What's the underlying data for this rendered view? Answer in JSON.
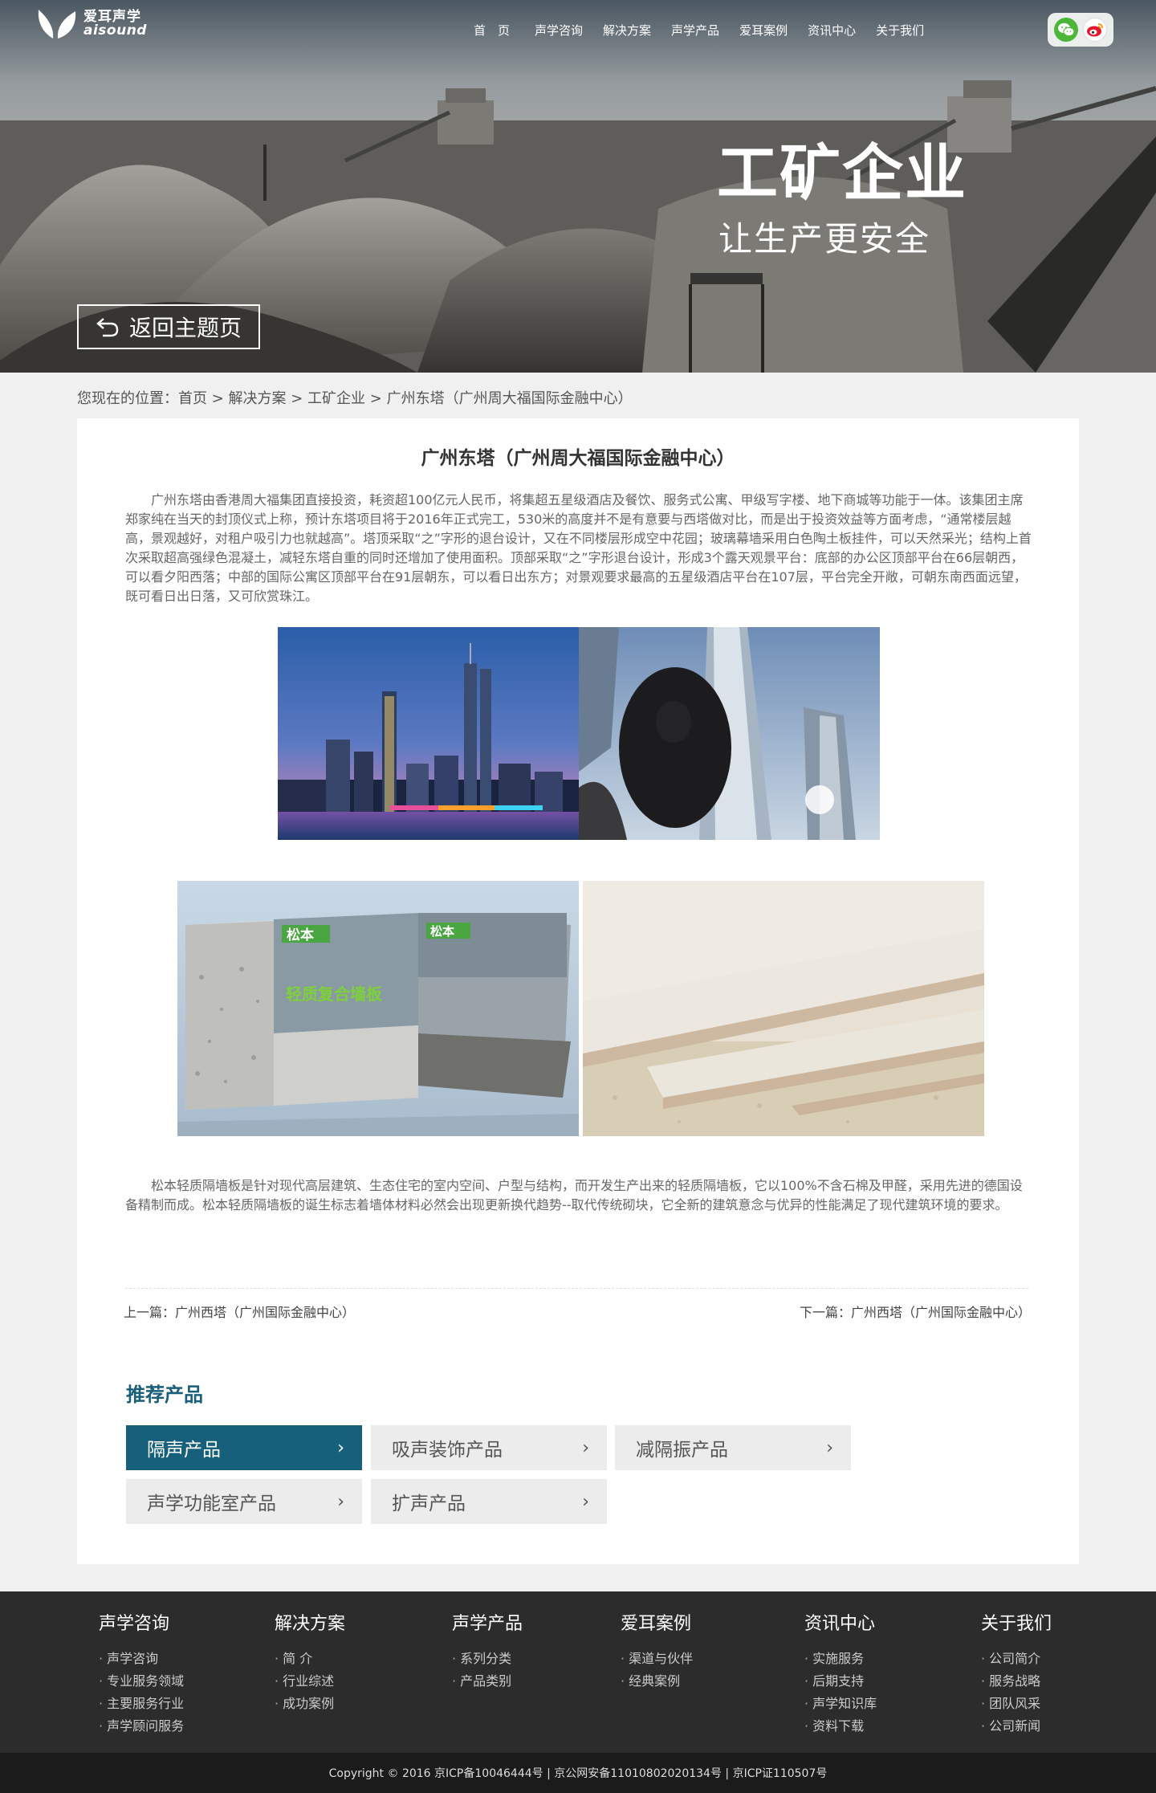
{
  "brand": {
    "name_cn": "爱耳声学",
    "name_en": "aisound"
  },
  "nav": [
    "首　页",
    "声学咨询",
    "解决方案",
    "声学产品",
    "爱耳案例",
    "资讯中心",
    "关于我们"
  ],
  "hero": {
    "title": "工矿企业",
    "subtitle": "让生产更安全",
    "back_label": "返回主题页"
  },
  "breadcrumb": {
    "text": "您现在的位置：首页 > 解决方案 > 工矿企业 > 广州东塔（广州周大福国际金融中心）"
  },
  "article": {
    "title": "广州东塔（广州周大福国际金融中心）",
    "paragraph1": "广州东塔由香港周大福集团直接投资，耗资超100亿元人民币，将集超五星级酒店及餐饮、服务式公寓、甲级写字楼、地下商城等功能于一体。该集团主席郑家纯在当天的封顶仪式上称，预计东塔项目将于2016年正式完工，530米的高度并不是有意要与西塔做对比，而是出于投资效益等方面考虑，“通常楼层越高，景观越好，对租户吸引力也就越高”。塔顶采取“之”字形的退台设计，又在不同楼层形成空中花园；玻璃幕墙采用白色陶土板挂件，可以天然采光；结构上首次采取超高强绿色混凝土，减轻东塔自重的同时还增加了使用面积。顶部采取“之”字形退台设计，形成3个露天观景平台：底部的办公区顶部平台在66层朝西，可以看夕阳西落；中部的国际公寓区顶部平台在91层朝东，可以看日出东方；对景观要求最高的五星级酒店平台在107层，平台完全开敞，可朝东南西面远望，既可看日出日落，又可欣赏珠江。",
    "paragraph2": "松本轻质隔墙板是针对现代高层建筑、生态住宅的室内空间、户型与结构，而开发生产出来的轻质隔墙板，它以100%不含石棉及甲醛，采用先进的德国设备精制而成。松本轻质隔墙板的诞生标志着墙体材料必然会出现更新换代趋势--取代传统砌块，它全新的建筑意念与优异的性能满足了现代建筑环境的要求。",
    "panel_brand": "松本",
    "panel_label": "轻质复合墙板",
    "prev": "上一篇：广州西塔（广州国际金融中心）",
    "next": "下一篇：广州西塔（广州国际金融中心）"
  },
  "recommend": {
    "title": "推荐产品",
    "items": [
      "隔声产品",
      "吸声装饰产品",
      "减隔振产品",
      "声学功能室产品",
      "扩声产品"
    ]
  },
  "footer": {
    "columns": [
      {
        "title": "声学咨询",
        "links": [
          "声学咨询",
          "专业服务领域",
          "主要服务行业",
          "声学顾问服务"
        ]
      },
      {
        "title": "解决方案",
        "links": [
          "简 介",
          "行业综述",
          "成功案例"
        ]
      },
      {
        "title": "声学产品",
        "links": [
          "系列分类",
          "产品类别"
        ]
      },
      {
        "title": "爱耳案例",
        "links": [
          "渠道与伙伴",
          "经典案例"
        ]
      },
      {
        "title": "资讯中心",
        "links": [
          "实施服务",
          "后期支持",
          "声学知识库",
          "资料下载"
        ]
      },
      {
        "title": "关于我们",
        "links": [
          "公司简介",
          "服务战略",
          "团队风采",
          "公司新闻"
        ]
      }
    ],
    "copyright": "Copyright © 2016  京ICP备10046444号 | 京公网安备11010802020134号 | 京ICP证110507号"
  }
}
